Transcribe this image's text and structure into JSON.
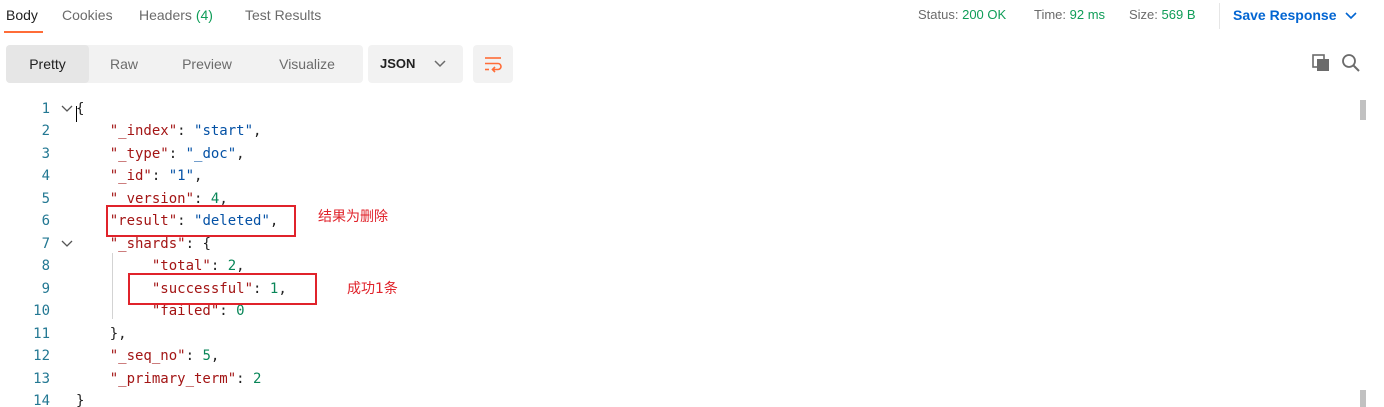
{
  "response_tabs": [
    {
      "label": "Body"
    },
    {
      "label": "Cookies"
    },
    {
      "label": "Headers",
      "count": "(4)"
    },
    {
      "label": "Test Results"
    }
  ],
  "status": {
    "status_label": "Status:",
    "status_value": "200 OK",
    "time_label": "Time:",
    "time_value": "92 ms",
    "size_label": "Size:",
    "size_value": "569 B"
  },
  "save_response": "Save Response",
  "view_modes": [
    "Pretty",
    "Raw",
    "Preview",
    "Visualize"
  ],
  "format": "JSON",
  "icons": {
    "wrap": "wrap-lines-icon",
    "copy": "copy-icon",
    "search": "search-icon",
    "fold": "chevron-down-icon"
  },
  "colors": {
    "accent": "#ff6c37",
    "link": "#0265d2",
    "success": "#0f9d58",
    "annotation": "#e0232b"
  },
  "code_lines": [
    {
      "num": "1",
      "text": "{"
    },
    {
      "num": "2",
      "key": "\"_index\"",
      "sep": ": ",
      "value": "\"start\"",
      "end": ","
    },
    {
      "num": "3",
      "key": "\"_type\"",
      "sep": ": ",
      "value": "\"_doc\"",
      "end": ","
    },
    {
      "num": "4",
      "key": "\"_id\"",
      "sep": ": ",
      "value": "\"1\"",
      "end": ","
    },
    {
      "num": "5",
      "key": "\"_version\"",
      "sep": ": ",
      "value": "4",
      "end": ","
    },
    {
      "num": "6",
      "key": "\"result\"",
      "sep": ": ",
      "value": "\"deleted\"",
      "end": ","
    },
    {
      "num": "7",
      "key": "\"_shards\"",
      "sep": ": ",
      "value": "{",
      "end": ""
    },
    {
      "num": "8",
      "key": "\"total\"",
      "sep": ": ",
      "value": "2",
      "end": ","
    },
    {
      "num": "9",
      "key": "\"successful\"",
      "sep": ": ",
      "value": "1",
      "end": ","
    },
    {
      "num": "10",
      "key": "\"failed\"",
      "sep": ": ",
      "value": "0",
      "end": ""
    },
    {
      "num": "11",
      "text": "},"
    },
    {
      "num": "12",
      "key": "\"_seq_no\"",
      "sep": ": ",
      "value": "5",
      "end": ","
    },
    {
      "num": "13",
      "key": "\"_primary_term\"",
      "sep": ": ",
      "value": "2",
      "end": ""
    },
    {
      "num": "14",
      "text": "}"
    }
  ],
  "annotations": {
    "result_note": "结果为删除",
    "successful_note": "成功1条"
  }
}
